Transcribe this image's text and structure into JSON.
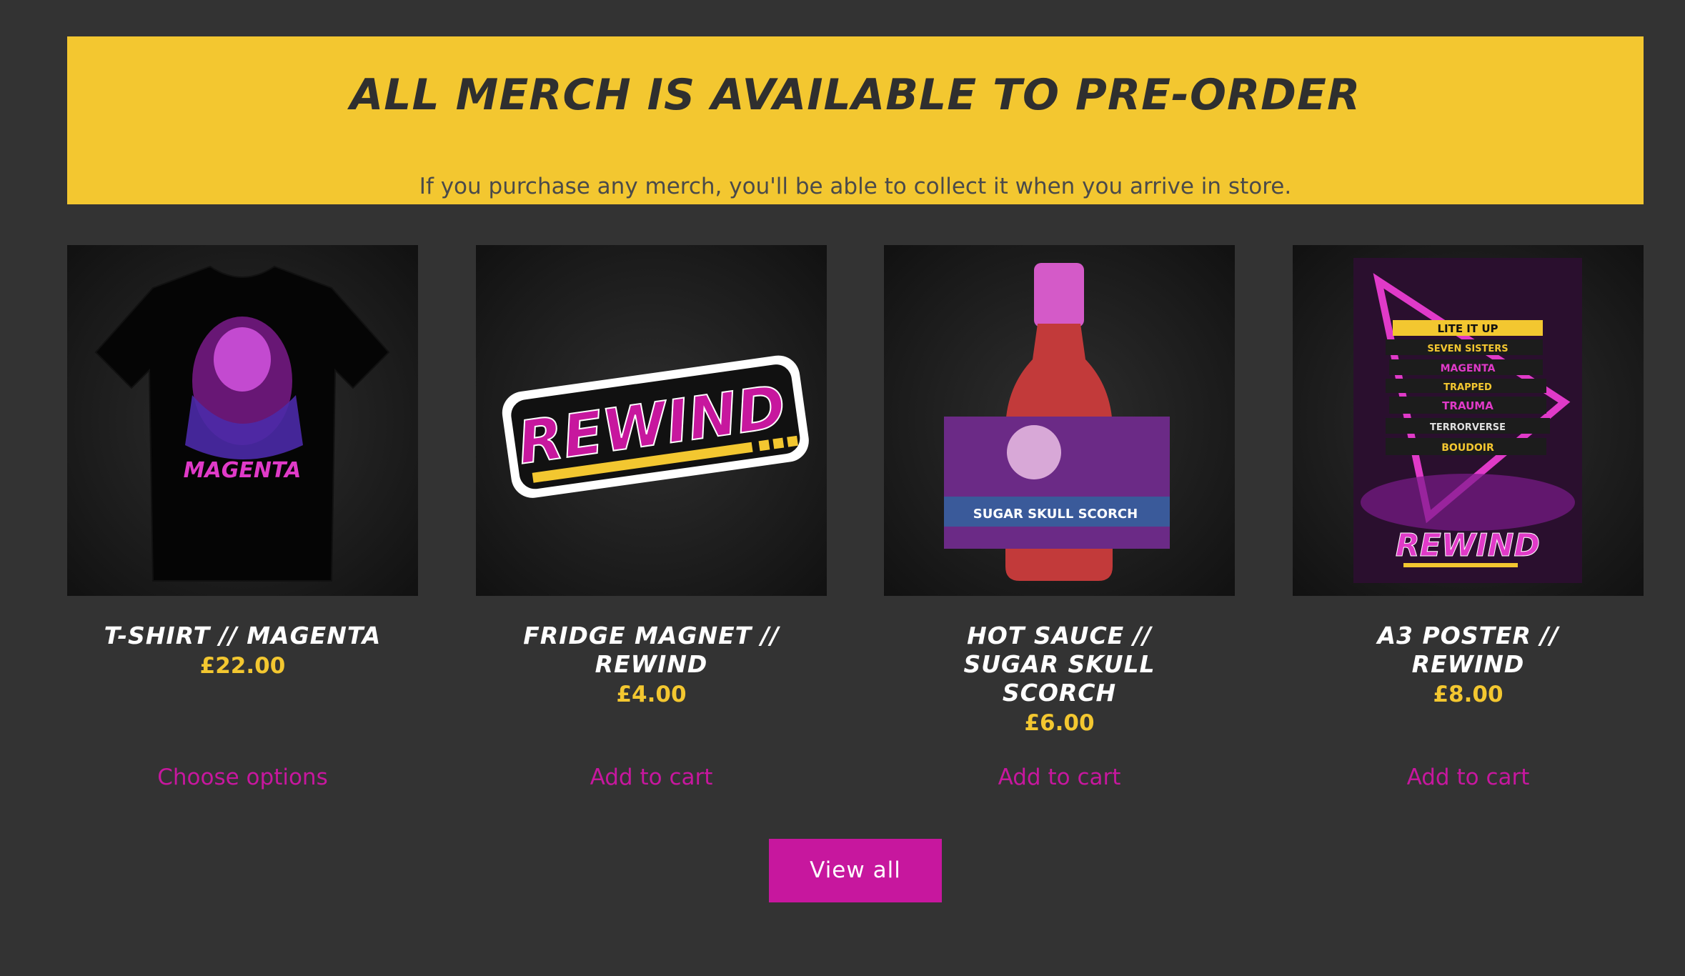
{
  "banner": {
    "title": "ALL MERCH IS AVAILABLE TO PRE-ORDER",
    "subtitle": "If you purchase any merch, you'll be able to collect it when you arrive in store."
  },
  "products": [
    {
      "title": "T-SHIRT // MAGENTA",
      "price": "£22.00",
      "action": "Choose options",
      "image_text": "MAGENTA"
    },
    {
      "title": "FRIDGE MAGNET // REWIND",
      "price": "£4.00",
      "action": "Add to cart",
      "image_text": "REWIND"
    },
    {
      "title": "HOT SAUCE // SUGAR SKULL SCORCH",
      "price": "£6.00",
      "action": "Add to cart",
      "image_text": "SUGAR SKULL SCORCH"
    },
    {
      "title": "A3 POSTER // REWIND",
      "price": "£8.00",
      "action": "Add to cart",
      "image_text": "REWIND",
      "poster_titles": [
        "LITE IT UP",
        "SEVEN SISTERS",
        "MAGENTA",
        "TRAPPED",
        "TRAUMA",
        "TERRORVERSE",
        "BOUDOIR"
      ]
    }
  ],
  "view_all_label": "View all",
  "colors": {
    "background": "#333333",
    "banner": "#f3c730",
    "accent": "#c7179e",
    "price": "#f3c730"
  }
}
